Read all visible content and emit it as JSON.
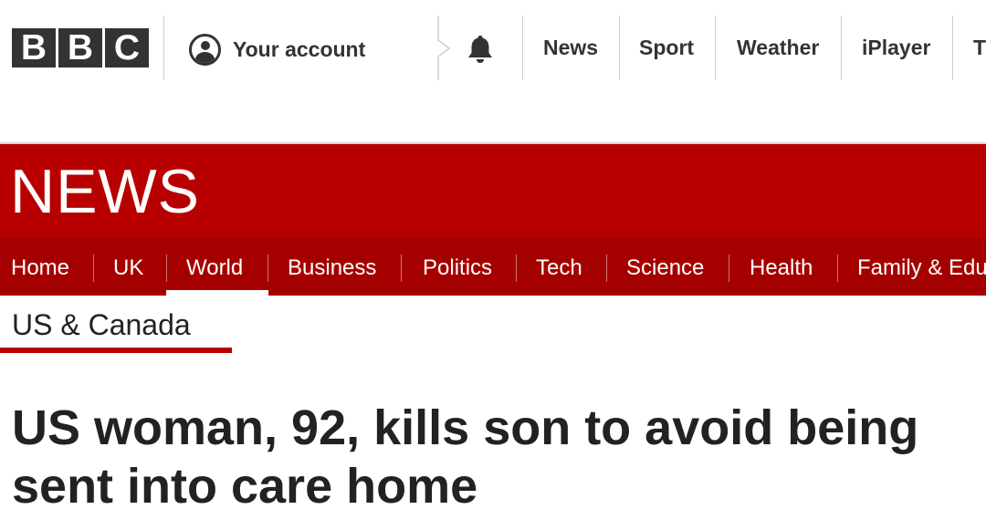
{
  "topbar": {
    "logo_letters": [
      "B",
      "B",
      "C"
    ],
    "account_label": "Your account",
    "account_icon": "user-circle-icon",
    "notification_icon": "bell-icon",
    "nav": [
      "News",
      "Sport",
      "Weather",
      "iPlayer",
      "T"
    ]
  },
  "section": {
    "title": "NEWS",
    "nav": [
      "Home",
      "UK",
      "World",
      "Business",
      "Politics",
      "Tech",
      "Science",
      "Health",
      "Family & Edu"
    ],
    "active": "World"
  },
  "subnav": {
    "label": "US & Canada"
  },
  "article": {
    "headline_line1": "US woman, 92, kills son to avoid being",
    "headline_line2": "sent into care home"
  },
  "colors": {
    "brand_red": "#b80000",
    "nav_red": "#a50000",
    "logo_dark": "#333333"
  }
}
